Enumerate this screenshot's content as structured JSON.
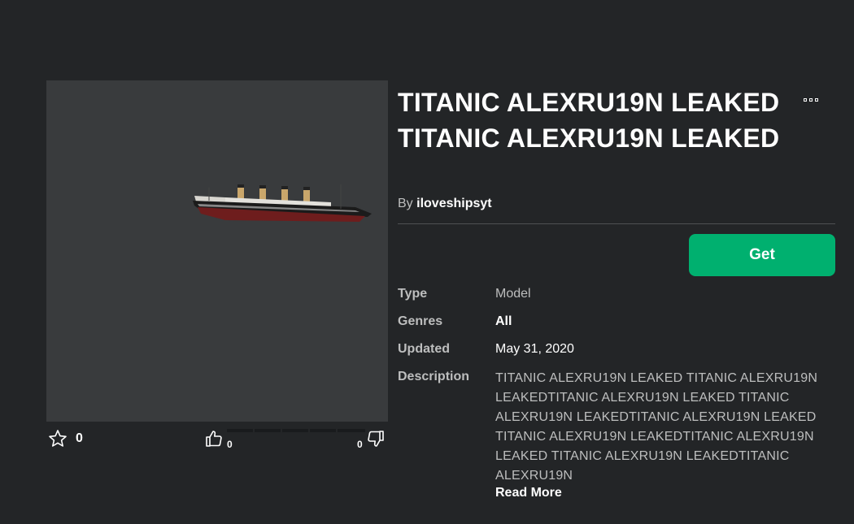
{
  "item": {
    "title": "TITANIC ALEXRU19N LEAKED TITANIC ALEXRU19N LEAKED",
    "by_label": "By",
    "creator": "iloveshipsyt",
    "get_label": "Get"
  },
  "votes": {
    "favorites": "0",
    "upvotes": "0",
    "downvotes": "0"
  },
  "details": {
    "type_label": "Type",
    "type_value": "Model",
    "genres_label": "Genres",
    "genres_value": "All",
    "updated_label": "Updated",
    "updated_value": "May 31, 2020",
    "description_label": "Description",
    "description_value": "TITANIC ALEXRU19N LEAKED TITANIC ALEXRU19N LEAKEDTITANIC ALEXRU19N LEAKED TITANIC ALEXRU19N LEAKEDTITANIC ALEXRU19N LEAKED TITANIC ALEXRU19N LEAKEDTITANIC ALEXRU19N LEAKED TITANIC ALEXRU19N LEAKEDTITANIC ALEXRU19N",
    "read_more": "Read More"
  },
  "colors": {
    "background": "#232527",
    "thumbnail_bg": "#393b3d",
    "get_button": "#00b06f",
    "muted_text": "#bdbebe"
  },
  "icons": [
    "star-icon",
    "thumbs-up-icon",
    "thumbs-down-icon",
    "more-options-icon"
  ]
}
